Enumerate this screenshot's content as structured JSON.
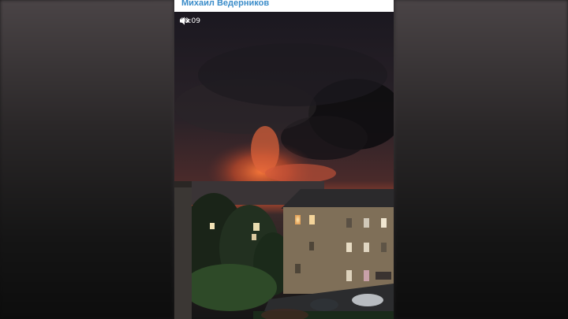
{
  "post": {
    "author": "Михаил Ведерников"
  },
  "video": {
    "timestamp": "00:09",
    "sound_icon": "muted-speaker-icon"
  }
}
